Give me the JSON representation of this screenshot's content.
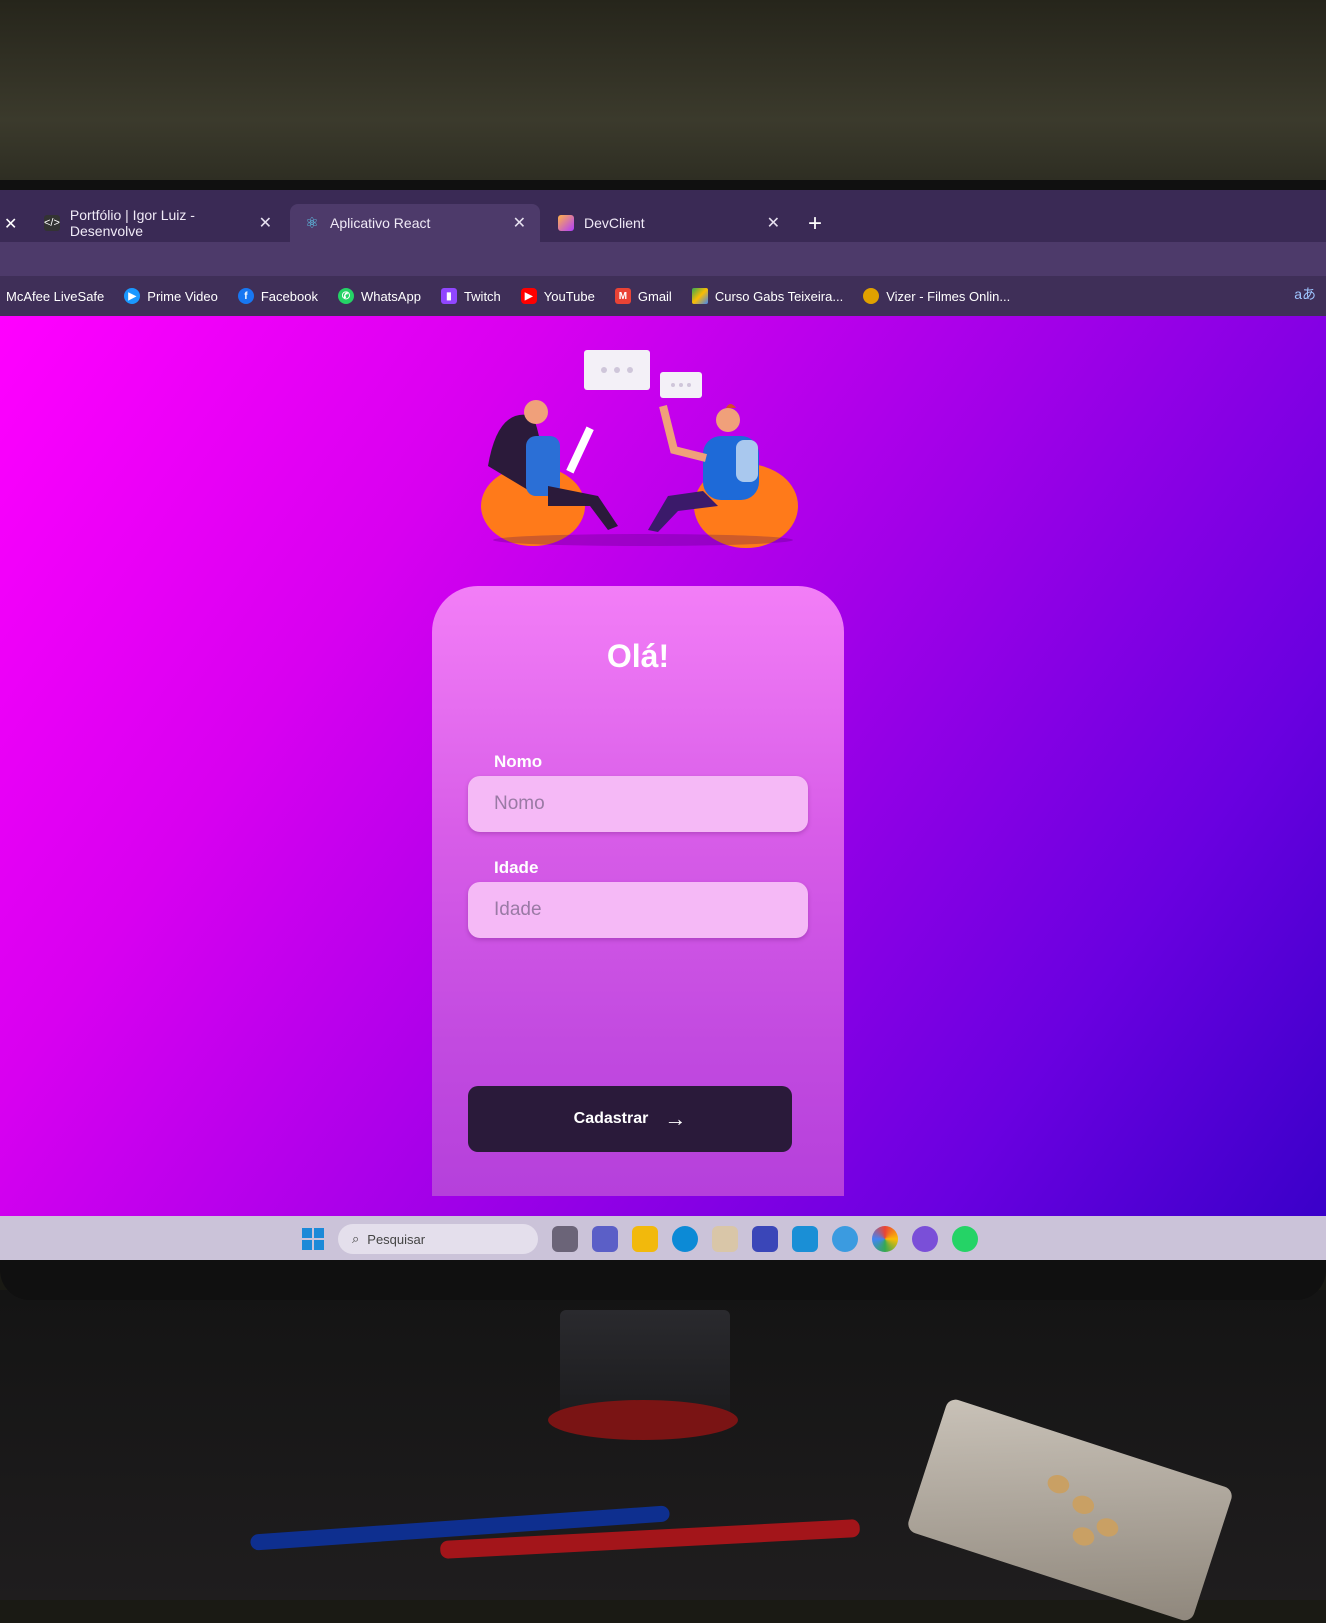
{
  "browser": {
    "tabs": [
      {
        "title": "Portfólio | Igor Luiz - Desenvolve",
        "favicon": "code-icon"
      },
      {
        "title": "Aplicativo React",
        "favicon": "react-icon"
      },
      {
        "title": "DevClient",
        "favicon": "devclient-icon"
      }
    ],
    "bookmarks": [
      {
        "label": "McAfee LiveSafe",
        "icon": "none"
      },
      {
        "label": "Prime Video",
        "icon": "play-icon"
      },
      {
        "label": "Facebook",
        "icon": "facebook-icon"
      },
      {
        "label": "WhatsApp",
        "icon": "whatsapp-icon"
      },
      {
        "label": "Twitch",
        "icon": "twitch-icon"
      },
      {
        "label": "YouTube",
        "icon": "youtube-icon"
      },
      {
        "label": "Gmail",
        "icon": "gmail-icon"
      },
      {
        "label": "Curso Gabs Teixeira...",
        "icon": "drive-icon"
      },
      {
        "label": "Vizer - Filmes Onlin...",
        "icon": "vizer-icon"
      }
    ]
  },
  "form": {
    "title": "Olá!",
    "name_label": "Nomo",
    "name_placeholder": "Nomo",
    "age_label": "Idade",
    "age_placeholder": "Idade",
    "submit_label": "Cadastrar"
  },
  "taskbar": {
    "search_placeholder": "Pesquisar"
  },
  "colors": {
    "page_gradient_start": "#ff00ff",
    "page_gradient_end": "#3a00c9",
    "card_top": "#f37ef7",
    "button_bg": "#2a1a3a"
  }
}
